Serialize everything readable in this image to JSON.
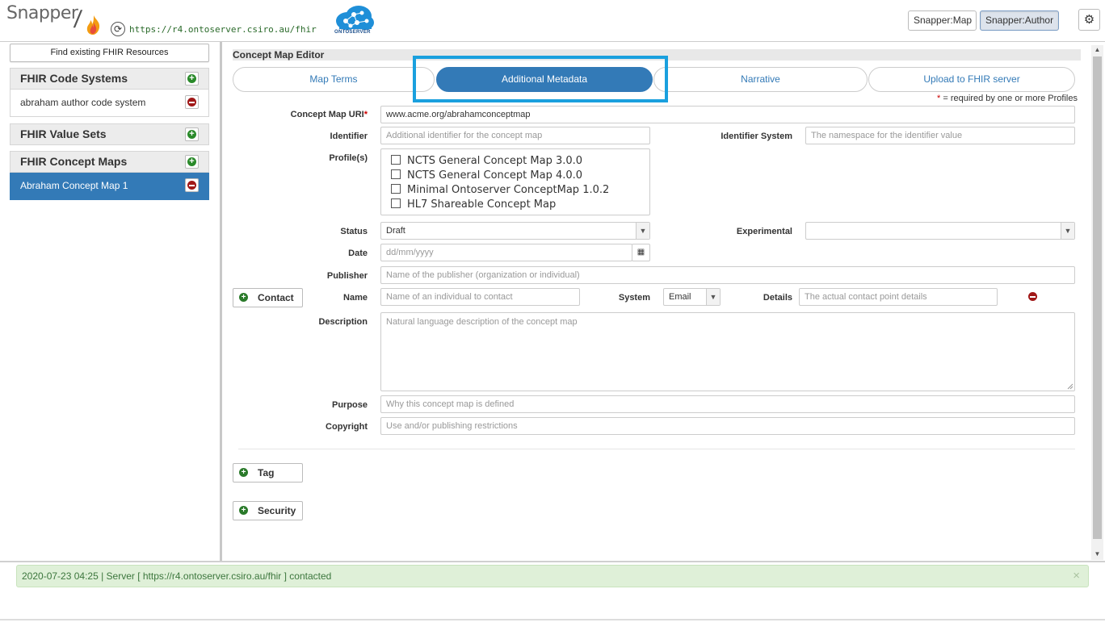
{
  "header": {
    "app_name": "Snapper",
    "server_url": "https://r4.ontoserver.csiro.au/fhir",
    "onto_logo_text": "ONTOSERVER",
    "mode_buttons": [
      "Snapper:Map",
      "Snapper:Author"
    ],
    "active_mode": "Snapper:Author",
    "icons": {
      "refresh": "refresh-icon",
      "settings": "gear-icon",
      "logo": "flame-icon"
    }
  },
  "sidebar": {
    "find_button": "Find existing FHIR Resources",
    "sections": [
      {
        "title": "FHIR Code Systems",
        "items": [
          "abraham author code system"
        ]
      },
      {
        "title": "FHIR Value Sets",
        "items": []
      },
      {
        "title": "FHIR Concept Maps",
        "items": [
          "Abraham Concept Map 1"
        ]
      }
    ],
    "selected_item": "Abraham Concept Map 1"
  },
  "editor": {
    "title": "Concept Map Editor",
    "tabs": [
      "Map Terms",
      "Additional Metadata",
      "Narrative",
      "Upload to FHIR server"
    ],
    "active_tab": "Additional Metadata",
    "required_star": "*",
    "required_note": "= required by one or more Profiles",
    "fields": {
      "uri": {
        "label": "Concept Map URI",
        "value": "www.acme.org/abrahamconceptmap"
      },
      "identifier": {
        "label": "Identifier",
        "placeholder": "Additional identifier for the concept map"
      },
      "identifier_system": {
        "label": "Identifier System",
        "placeholder": "The namespace for the identifier value"
      },
      "profiles": {
        "label": "Profile(s)",
        "options": [
          "NCTS General Concept Map 3.0.0",
          "NCTS General Concept Map 4.0.0",
          "Minimal Ontoserver ConceptMap 1.0.2",
          "HL7 Shareable Concept Map"
        ]
      },
      "status": {
        "label": "Status",
        "value": "Draft"
      },
      "experimental": {
        "label": "Experimental",
        "value": ""
      },
      "date": {
        "label": "Date",
        "placeholder": "dd/mm/yyyy"
      },
      "publisher": {
        "label": "Publisher",
        "placeholder": "Name of the publisher (organization or individual)"
      },
      "contact": {
        "button": "Contact",
        "name_label": "Name",
        "name_placeholder": "Name of an individual to contact",
        "system_label": "System",
        "system_value": "Email",
        "details_label": "Details",
        "details_placeholder": "The actual contact point details"
      },
      "description": {
        "label": "Description",
        "placeholder": "Natural language description of the concept map"
      },
      "purpose": {
        "label": "Purpose",
        "placeholder": "Why this concept map is defined"
      },
      "copyright": {
        "label": "Copyright",
        "placeholder": "Use and/or publishing restrictions"
      }
    },
    "buttons": {
      "tag": "Tag",
      "security": "Security"
    }
  },
  "status": {
    "message": "2020-07-23 04:25 | Server [ https://r4.ontoserver.csiro.au/fhir ] contacted",
    "close": "×"
  },
  "colors": {
    "accent": "#337ab7",
    "highlight": "#1aa0de",
    "success_bg": "#dff0d8",
    "add": "#2a8a2a",
    "remove": "#a01818"
  }
}
